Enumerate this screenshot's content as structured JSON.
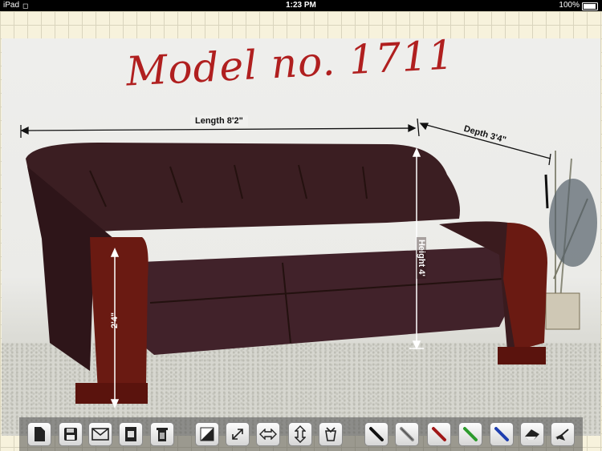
{
  "status_bar": {
    "carrier": "iPad",
    "time": "1:23 PM",
    "battery": "100%"
  },
  "annotation": {
    "title": "Model no. 1711"
  },
  "dimensions": {
    "length": "Length 8'2\"",
    "depth": "Depth 3'4\"",
    "height": "Height 4'",
    "arm_height": "2'4\""
  },
  "toolbar": {
    "tools": [
      {
        "name": "new-document",
        "icon": "document-icon"
      },
      {
        "name": "save",
        "icon": "floppy-disk-icon"
      },
      {
        "name": "email",
        "icon": "envelope-icon"
      },
      {
        "name": "photo-import",
        "icon": "photo-icon"
      },
      {
        "name": "delete",
        "icon": "trash-icon"
      },
      {
        "name": "contrast",
        "icon": "contrast-icon"
      },
      {
        "name": "diagonal-arrow",
        "icon": "diagonal-arrow-icon"
      },
      {
        "name": "horizontal-arrow",
        "icon": "horizontal-arrow-icon"
      },
      {
        "name": "vertical-arrow",
        "icon": "vertical-arrow-icon"
      },
      {
        "name": "bucket",
        "icon": "bucket-icon"
      },
      {
        "name": "black-pen",
        "icon": "black-pen-icon",
        "color": "#111111"
      },
      {
        "name": "pencil",
        "icon": "pencil-icon",
        "color": "#888888"
      },
      {
        "name": "red-pen",
        "icon": "red-pen-icon",
        "color": "#a01818"
      },
      {
        "name": "green-pen",
        "icon": "green-pen-icon",
        "color": "#2c9a2c"
      },
      {
        "name": "blue-pen",
        "icon": "blue-pen-icon",
        "color": "#1f3fb0"
      },
      {
        "name": "eraser",
        "icon": "eraser-icon"
      },
      {
        "name": "clear-all",
        "icon": "sweep-icon"
      }
    ]
  },
  "colors": {
    "ink_red": "#b01f1f",
    "sofa_leather": "#3b1e22",
    "sofa_wood": "#6a1a12"
  }
}
